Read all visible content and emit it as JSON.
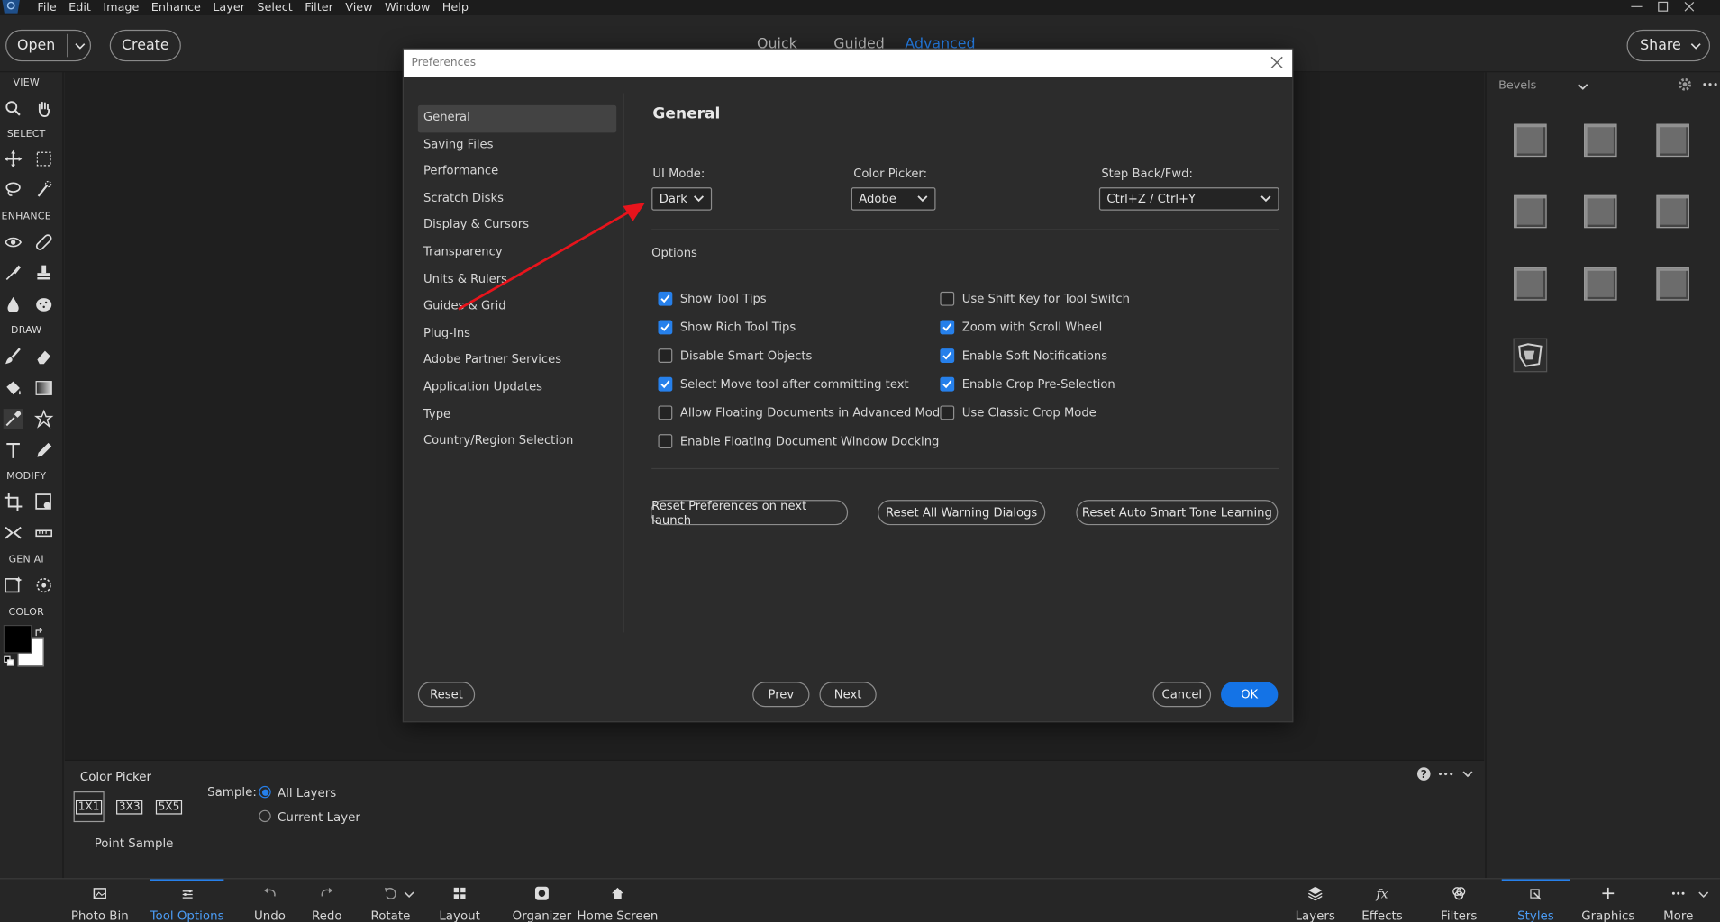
{
  "menubar": {
    "items": [
      "File",
      "Edit",
      "Image",
      "Enhance",
      "Layer",
      "Select",
      "Filter",
      "View",
      "Window",
      "Help"
    ]
  },
  "header": {
    "open_label": "Open",
    "create_label": "Create",
    "modes": [
      "Quick",
      "Guided",
      "Advanced"
    ],
    "active_mode": "Advanced",
    "share_label": "Share"
  },
  "toolbar": {
    "sections": [
      "VIEW",
      "SELECT",
      "ENHANCE",
      "DRAW",
      "MODIFY",
      "GEN AI",
      "COLOR"
    ],
    "tools": [
      "zoom-icon",
      "hand-icon",
      "move-icon",
      "marquee-icon",
      "lasso-icon",
      "quick-selection-icon",
      "red-eye-icon",
      "spot-healing-icon",
      "smart-brush-icon",
      "clone-stamp-icon",
      "blur-icon",
      "sponge-icon",
      "brush-icon",
      "eraser-icon",
      "paint-bucket-icon",
      "gradient-icon",
      "eyedropper-icon",
      "shape-icon",
      "type-icon",
      "pencil-icon",
      "crop-icon",
      "recompose-icon",
      "content-aware-move-icon",
      "straighten-icon",
      "generative-fill-icon",
      "generative-remove-icon"
    ],
    "foreground_color": "#000000",
    "background_color": "#ffffff"
  },
  "right_panel": {
    "category": "Bevels",
    "thumbnail_count": 10
  },
  "tool_options": {
    "title": "Color Picker",
    "sizes": [
      "1X1",
      "3X3",
      "5X5"
    ],
    "size_caption": "Point Sample",
    "sample_label": "Sample:",
    "sample_options": [
      "All Layers",
      "Current Layer"
    ],
    "sample_selected": "All Layers"
  },
  "bottom_bar": {
    "left": [
      "Photo Bin",
      "Tool Options",
      "Undo",
      "Redo",
      "Rotate",
      "Layout",
      "Organizer",
      "Home Screen"
    ],
    "right": [
      "Layers",
      "Effects",
      "Filters",
      "Styles",
      "Graphics",
      "More"
    ],
    "active_left": "Tool Options",
    "active_right": "Styles"
  },
  "dialog": {
    "title": "Preferences",
    "categories": [
      "General",
      "Saving Files",
      "Performance",
      "Scratch Disks",
      "Display & Cursors",
      "Transparency",
      "Units & Rulers",
      "Guides & Grid",
      "Plug-Ins",
      "Adobe Partner Services",
      "Application Updates",
      "Type",
      "Country/Region Selection"
    ],
    "selected_category": "General",
    "heading": "General",
    "ui_mode": {
      "label": "UI Mode:",
      "value": "Dark"
    },
    "color_picker": {
      "label": "Color Picker:",
      "value": "Adobe"
    },
    "step_back": {
      "label": "Step Back/Fwd:",
      "value": "Ctrl+Z / Ctrl+Y"
    },
    "options_label": "Options",
    "options_left": [
      {
        "label": "Show Tool Tips",
        "checked": true
      },
      {
        "label": "Show Rich Tool Tips",
        "checked": true
      },
      {
        "label": "Disable Smart Objects",
        "checked": false
      },
      {
        "label": "Select Move tool after committing text",
        "checked": true
      },
      {
        "label": "Allow Floating Documents in Advanced Mode",
        "checked": false
      },
      {
        "label": "Enable Floating Document Window Docking",
        "checked": false
      }
    ],
    "options_right": [
      {
        "label": "Use Shift Key for Tool Switch",
        "checked": false
      },
      {
        "label": "Zoom with Scroll Wheel",
        "checked": true
      },
      {
        "label": "Enable Soft Notifications",
        "checked": true
      },
      {
        "label": "Enable Crop Pre-Selection",
        "checked": true
      },
      {
        "label": "Use Classic Crop Mode",
        "checked": false
      }
    ],
    "reset_buttons": [
      "Reset Preferences on next launch",
      "Reset All Warning Dialogs",
      "Reset Auto Smart Tone Learning"
    ],
    "footer": {
      "reset": "Reset",
      "prev": "Prev",
      "next": "Next",
      "cancel": "Cancel",
      "ok": "OK"
    }
  },
  "colors": {
    "accent": "#2680eb",
    "annotation_arrow": "#e8141c",
    "dialog_bg": "#2c2c2c",
    "app_bg": "#262626"
  }
}
